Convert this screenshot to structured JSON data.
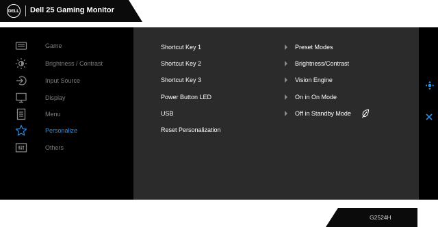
{
  "header": {
    "logo_text": "DELL",
    "title": "Dell 25 Gaming Monitor"
  },
  "menu": {
    "items": [
      {
        "label": "Game",
        "icon": "gamepad-icon"
      },
      {
        "label": "Brightness / Contrast",
        "icon": "brightness-icon"
      },
      {
        "label": "Input Source",
        "icon": "input-source-icon"
      },
      {
        "label": "Display",
        "icon": "display-icon"
      },
      {
        "label": "Menu",
        "icon": "menu-icon"
      },
      {
        "label": "Personalize",
        "icon": "star-icon",
        "active": true
      },
      {
        "label": "Others",
        "icon": "others-icon"
      }
    ]
  },
  "personalize": {
    "rows": [
      {
        "label": "Shortcut Key 1",
        "value": "Preset Modes"
      },
      {
        "label": "Shortcut Key 2",
        "value": "Brightness/Contrast"
      },
      {
        "label": "Shortcut Key 3",
        "value": "Vision Engine"
      },
      {
        "label": "Power Button LED",
        "value": "On in On Mode"
      },
      {
        "label": "USB",
        "value": "Off in Standby Mode",
        "extra_icon": "leaf-icon"
      },
      {
        "label": "Reset Personalization",
        "value": ""
      }
    ]
  },
  "right_controls": {
    "joystick_icon": "joystick-icon",
    "close_icon": "close-icon"
  },
  "footer": {
    "model": "G2524H"
  },
  "colors": {
    "active_accent": "#2c8fe0",
    "panel_bg": "#2b2b2b",
    "osd_bg": "#000000"
  }
}
